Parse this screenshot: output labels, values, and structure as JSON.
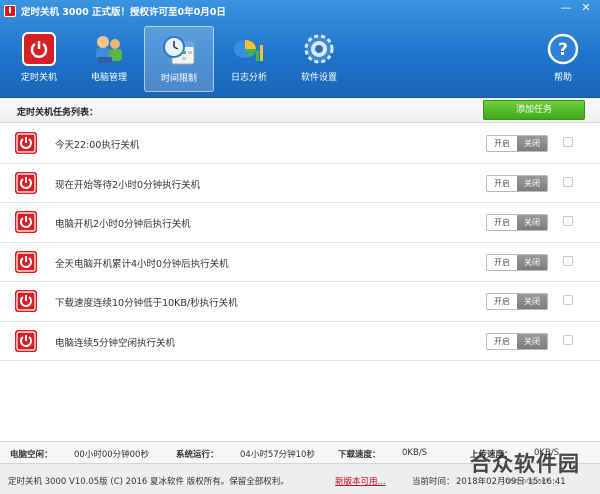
{
  "window": {
    "title": "定时关机 3000 正式版！授权许可至0年0月0日",
    "controls": [
      "—",
      "✕"
    ]
  },
  "toolbar": {
    "items": [
      {
        "label": "定时关机",
        "icon": "power-icon"
      },
      {
        "label": "电脑管理",
        "icon": "computer-manage-icon"
      },
      {
        "label": "时间限制",
        "icon": "clock-calendar-icon",
        "active": true
      },
      {
        "label": "日志分析",
        "icon": "log-chart-icon"
      },
      {
        "label": "软件设置",
        "icon": "gear-icon"
      },
      {
        "label": "帮助",
        "icon": "help-icon"
      }
    ]
  },
  "list": {
    "title": "定时关机任务列表：",
    "add_button": "添加任务"
  },
  "tasks": [
    {
      "text": "今天22:00执行关机",
      "on": "开启",
      "off": "关闭"
    },
    {
      "text": "现在开始等待2小时0分钟执行关机",
      "on": "开启",
      "off": "关闭"
    },
    {
      "text": "电脑开机2小时0分钟后执行关机",
      "on": "开启",
      "off": "关闭"
    },
    {
      "text": "全天电脑开机累计4小时0分钟后执行关机",
      "on": "开启",
      "off": "关闭"
    },
    {
      "text": "下载速度连续10分钟低于10KB/秒执行关机",
      "on": "开启",
      "off": "关闭"
    },
    {
      "text": "电脑连续5分钟空闲执行关机",
      "on": "开启",
      "off": "关闭"
    }
  ],
  "status": {
    "idle_label": "电脑空闲：",
    "idle_value": "00小时00分钟00秒",
    "run_label": "系统运行：",
    "run_value": "04小时57分钟10秒",
    "down_label": "下载速度：",
    "down_value": "0KB/S",
    "up_label": "上传速度：",
    "up_value": "0KB/S"
  },
  "footer": {
    "copyright": "定时关机 3000 V10.05版 (C) 2016  夏冰软件 版权所有。保留全部权利。",
    "new_version": "新版本可用...",
    "time_label": "当前时间：",
    "time_value": "2018年02月09日 15:16:41"
  },
  "watermark": {
    "text": "合众软件园",
    "url": "hezhong.net"
  },
  "colors": {
    "title_blue": "#1e73c9",
    "add_green": "#3ea81d",
    "power_red": "#d71f26",
    "link_red": "#d0021b"
  }
}
